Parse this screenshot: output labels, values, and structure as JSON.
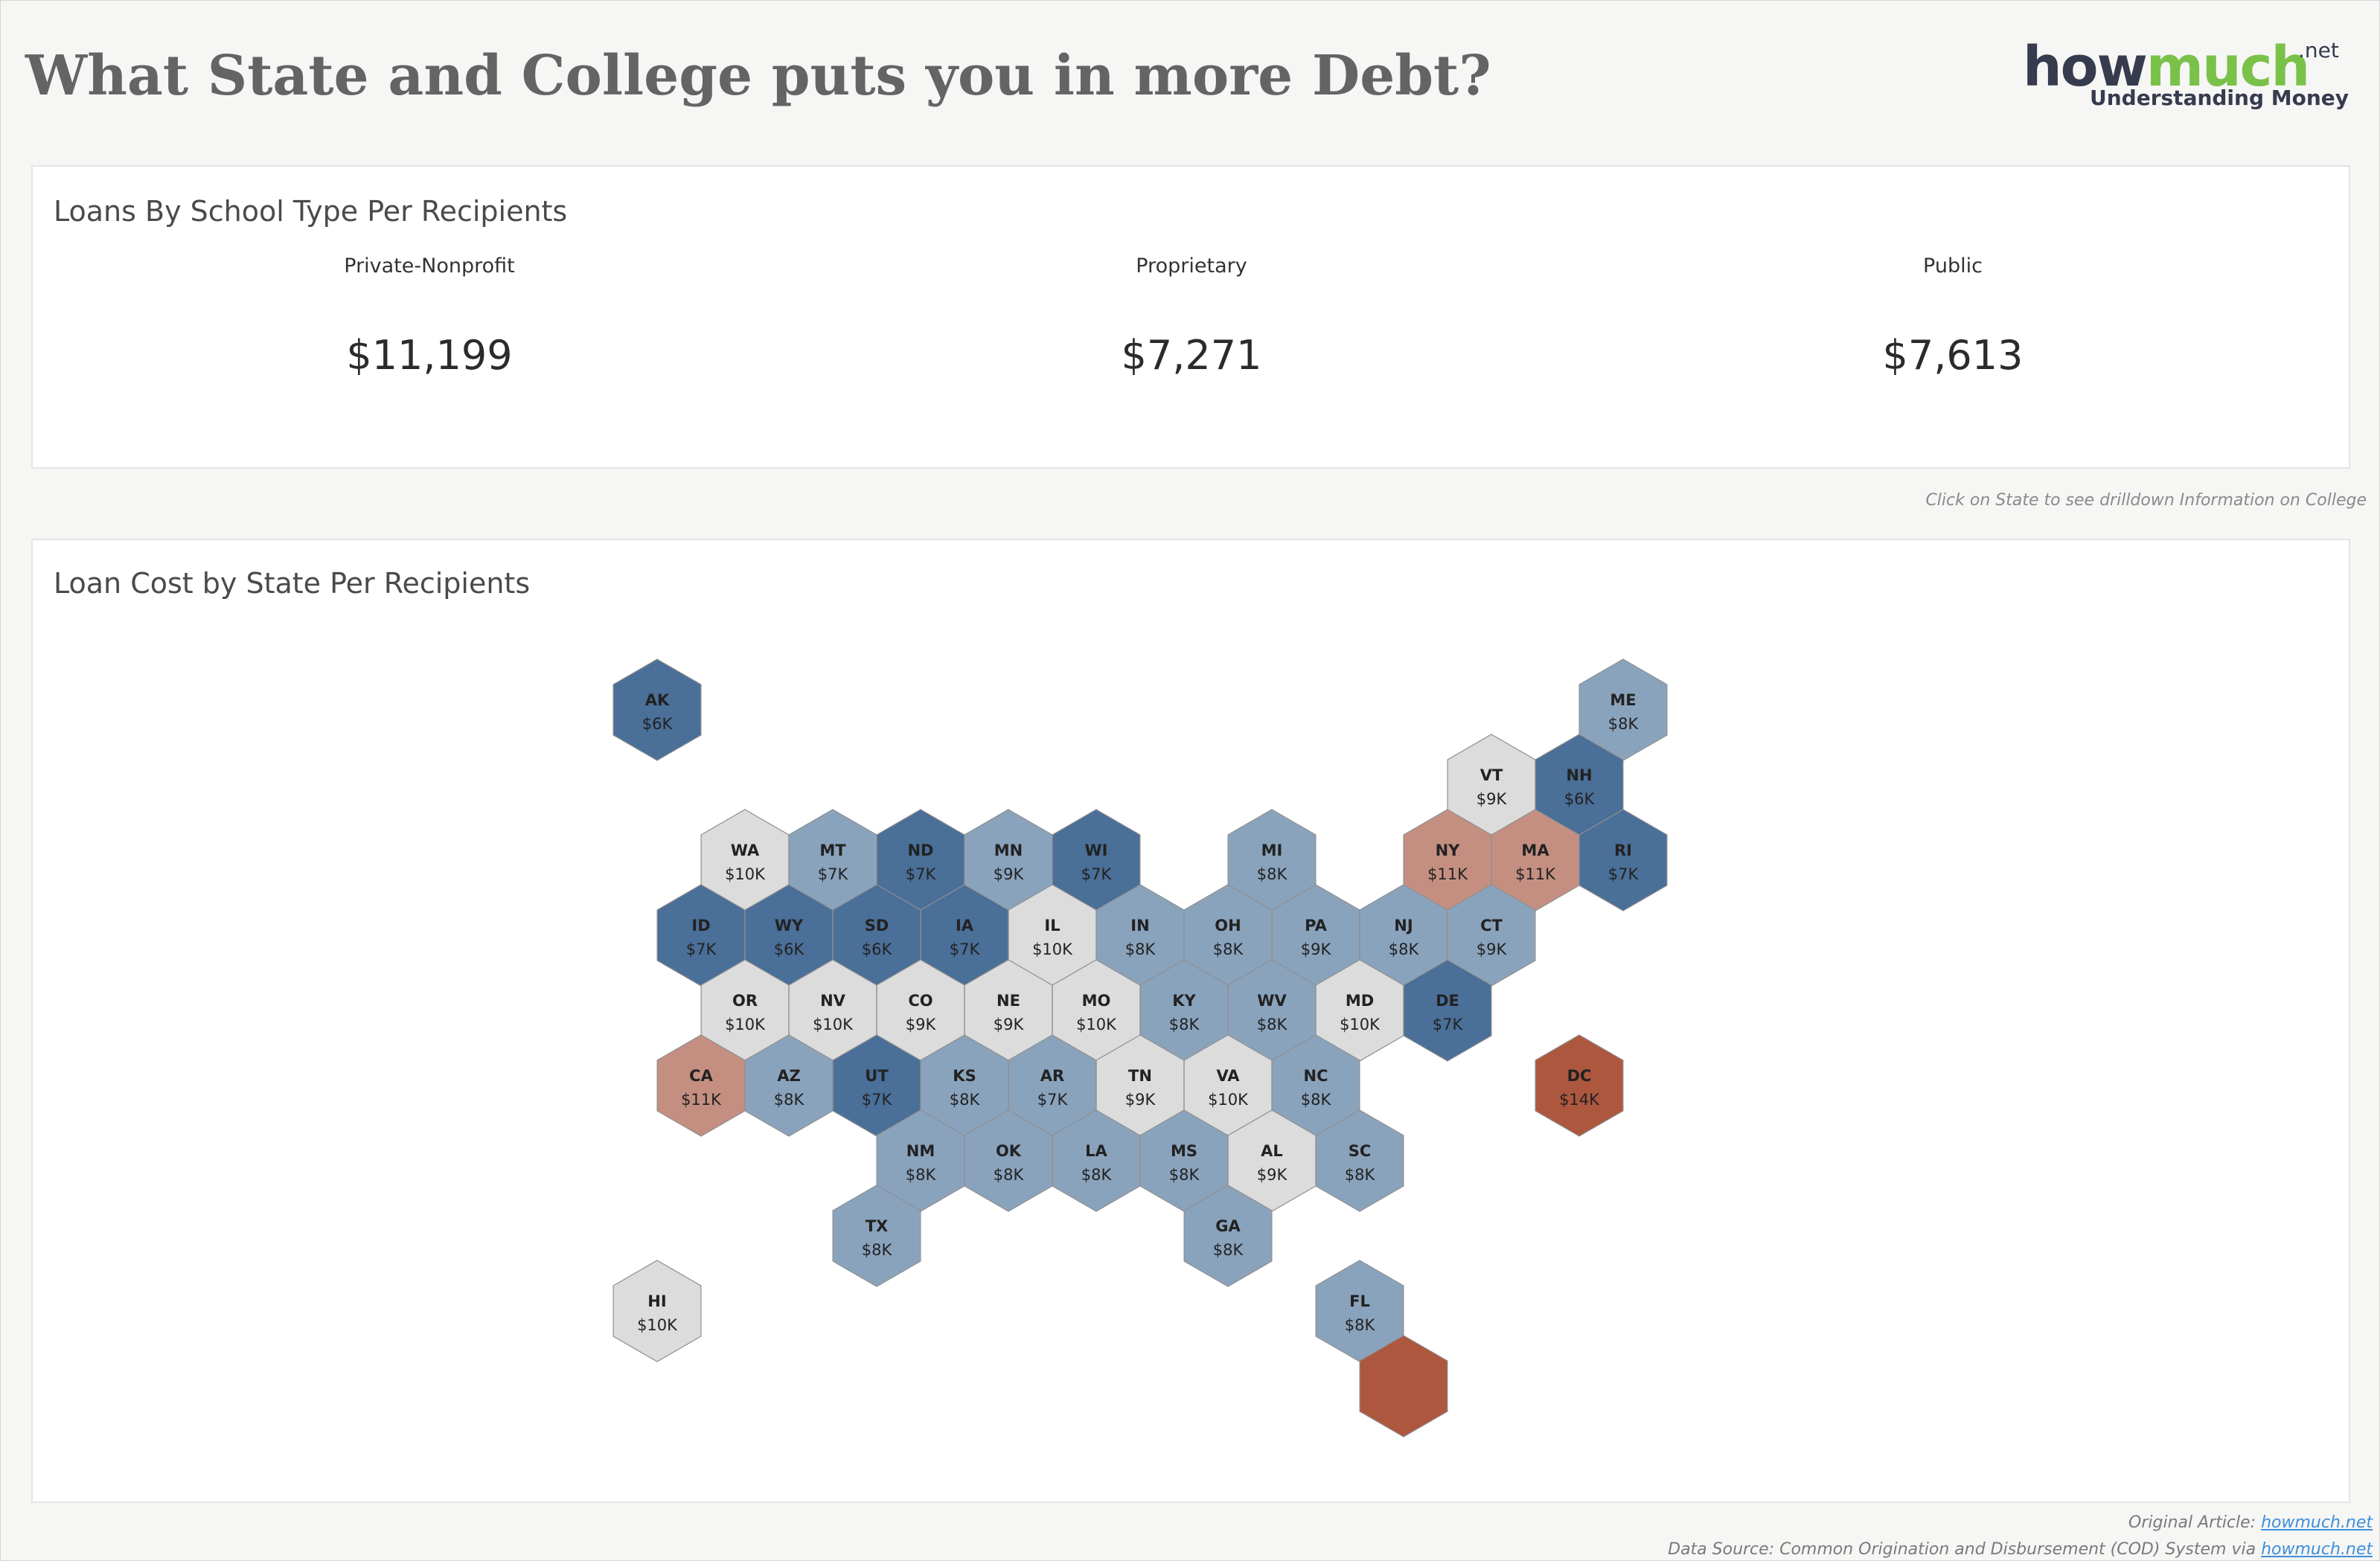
{
  "header": {
    "title": "What State and College puts you in more Debt?",
    "logo": {
      "how": "how",
      "much": "much",
      "tld": ".net",
      "tagline": "Understanding Money"
    }
  },
  "kpi_panel": {
    "title": "Loans By School Type Per Recipients",
    "items": [
      {
        "label": "Private-Nonprofit",
        "value": "$11,199"
      },
      {
        "label": "Proprietary",
        "value": "$7,271"
      },
      {
        "label": "Public",
        "value": "$7,613"
      }
    ]
  },
  "hint": "Click on State to see drilldown Information on College",
  "map_panel": {
    "title": "Loan Cost by State Per Recipients"
  },
  "colors": {
    "dark_blue": "#4a6f98",
    "mid_blue": "#8aa3bd",
    "neutral": "#dcdcdc",
    "salmon": "#c48f81",
    "dark_red": "#ad573e",
    "text_dark": "#222222",
    "text_light": "#f4f4f4"
  },
  "chart_data": {
    "type": "heatmap",
    "title": "Loan Cost by State Per Recipients",
    "states": [
      {
        "abbr": "AK",
        "value": "$6K",
        "color": "dark_blue",
        "col": 0,
        "row": 0
      },
      {
        "abbr": "ME",
        "value": "$8K",
        "color": "mid_blue",
        "col": 11,
        "row": 0
      },
      {
        "abbr": "VT",
        "value": "$9K",
        "color": "neutral",
        "col": 10,
        "row": 1
      },
      {
        "abbr": "NH",
        "value": "$6K",
        "color": "dark_blue",
        "col": 11,
        "row": 1
      },
      {
        "abbr": "WA",
        "value": "$10K",
        "color": "neutral",
        "col": 1,
        "row": 2
      },
      {
        "abbr": "MT",
        "value": "$7K",
        "color": "mid_blue",
        "col": 2,
        "row": 2
      },
      {
        "abbr": "ND",
        "value": "$7K",
        "color": "dark_blue",
        "col": 3,
        "row": 2
      },
      {
        "abbr": "MN",
        "value": "$9K",
        "color": "mid_blue",
        "col": 4,
        "row": 2
      },
      {
        "abbr": "WI",
        "value": "$7K",
        "color": "dark_blue",
        "col": 5,
        "row": 2
      },
      {
        "abbr": "MI",
        "value": "$8K",
        "color": "mid_blue",
        "col": 7,
        "row": 2
      },
      {
        "abbr": "NY",
        "value": "$11K",
        "color": "salmon",
        "col": 9,
        "row": 2
      },
      {
        "abbr": "MA",
        "value": "$11K",
        "color": "salmon",
        "col": 10,
        "row": 2
      },
      {
        "abbr": "RI",
        "value": "$7K",
        "color": "dark_blue",
        "col": 11,
        "row": 2
      },
      {
        "abbr": "ID",
        "value": "$7K",
        "color": "dark_blue",
        "col": 1,
        "row": 3
      },
      {
        "abbr": "WY",
        "value": "$6K",
        "color": "dark_blue",
        "col": 2,
        "row": 3
      },
      {
        "abbr": "SD",
        "value": "$6K",
        "color": "dark_blue",
        "col": 3,
        "row": 3
      },
      {
        "abbr": "IA",
        "value": "$7K",
        "color": "dark_blue",
        "col": 4,
        "row": 3
      },
      {
        "abbr": "IL",
        "value": "$10K",
        "color": "neutral",
        "col": 5,
        "row": 3
      },
      {
        "abbr": "IN",
        "value": "$8K",
        "color": "mid_blue",
        "col": 6,
        "row": 3
      },
      {
        "abbr": "OH",
        "value": "$8K",
        "color": "mid_blue",
        "col": 7,
        "row": 3
      },
      {
        "abbr": "PA",
        "value": "$9K",
        "color": "mid_blue",
        "col": 8,
        "row": 3
      },
      {
        "abbr": "NJ",
        "value": "$8K",
        "color": "mid_blue",
        "col": 9,
        "row": 3
      },
      {
        "abbr": "CT",
        "value": "$9K",
        "color": "mid_blue",
        "col": 10,
        "row": 3
      },
      {
        "abbr": "OR",
        "value": "$10K",
        "color": "neutral",
        "col": 1,
        "row": 4
      },
      {
        "abbr": "NV",
        "value": "$10K",
        "color": "neutral",
        "col": 2,
        "row": 4
      },
      {
        "abbr": "CO",
        "value": "$9K",
        "color": "neutral",
        "col": 3,
        "row": 4
      },
      {
        "abbr": "NE",
        "value": "$9K",
        "color": "neutral",
        "col": 4,
        "row": 4
      },
      {
        "abbr": "MO",
        "value": "$10K",
        "color": "neutral",
        "col": 5,
        "row": 4
      },
      {
        "abbr": "KY",
        "value": "$8K",
        "color": "mid_blue",
        "col": 6,
        "row": 4
      },
      {
        "abbr": "WV",
        "value": "$8K",
        "color": "mid_blue",
        "col": 7,
        "row": 4
      },
      {
        "abbr": "MD",
        "value": "$10K",
        "color": "neutral",
        "col": 8,
        "row": 4
      },
      {
        "abbr": "DE",
        "value": "$7K",
        "color": "dark_blue",
        "col": 9,
        "row": 4
      },
      {
        "abbr": "CA",
        "value": "$11K",
        "color": "salmon",
        "col": 1,
        "row": 5
      },
      {
        "abbr": "AZ",
        "value": "$8K",
        "color": "mid_blue",
        "col": 2,
        "row": 5
      },
      {
        "abbr": "UT",
        "value": "$7K",
        "color": "dark_blue",
        "col": 3,
        "row": 5
      },
      {
        "abbr": "KS",
        "value": "$8K",
        "color": "mid_blue",
        "col": 4,
        "row": 5
      },
      {
        "abbr": "AR",
        "value": "$7K",
        "color": "mid_blue",
        "col": 5,
        "row": 5
      },
      {
        "abbr": "TN",
        "value": "$9K",
        "color": "neutral",
        "col": 6,
        "row": 5
      },
      {
        "abbr": "VA",
        "value": "$10K",
        "color": "neutral",
        "col": 7,
        "row": 5
      },
      {
        "abbr": "NC",
        "value": "$8K",
        "color": "mid_blue",
        "col": 8,
        "row": 5
      },
      {
        "abbr": "DC",
        "value": "$14K",
        "color": "dark_red",
        "col": 11,
        "row": 5
      },
      {
        "abbr": "NM",
        "value": "$8K",
        "color": "mid_blue",
        "col": 3,
        "row": 6
      },
      {
        "abbr": "OK",
        "value": "$8K",
        "color": "mid_blue",
        "col": 4,
        "row": 6
      },
      {
        "abbr": "LA",
        "value": "$8K",
        "color": "mid_blue",
        "col": 5,
        "row": 6
      },
      {
        "abbr": "MS",
        "value": "$8K",
        "color": "mid_blue",
        "col": 6,
        "row": 6
      },
      {
        "abbr": "AL",
        "value": "$9K",
        "color": "neutral",
        "col": 7,
        "row": 6
      },
      {
        "abbr": "SC",
        "value": "$8K",
        "color": "mid_blue",
        "col": 8,
        "row": 6
      },
      {
        "abbr": "TX",
        "value": "$8K",
        "color": "mid_blue",
        "col": 3,
        "row": 7
      },
      {
        "abbr": "GA",
        "value": "$8K",
        "color": "mid_blue",
        "col": 7,
        "row": 7
      },
      {
        "abbr": "HI",
        "value": "$10K",
        "color": "neutral",
        "col": 0,
        "row": 8
      },
      {
        "abbr": "FL",
        "value": "$8K",
        "color": "mid_blue",
        "col": 8,
        "row": 8
      },
      {
        "abbr": "",
        "value": "",
        "color": "dark_red",
        "col": 9,
        "row": 9
      }
    ]
  },
  "footer": {
    "article_prefix": "Original Article: ",
    "article_link": "howmuch.net",
    "source_prefix": "Data Source: Common Origination and Disbursement (COD) System via ",
    "source_link": "howmuch.net"
  }
}
